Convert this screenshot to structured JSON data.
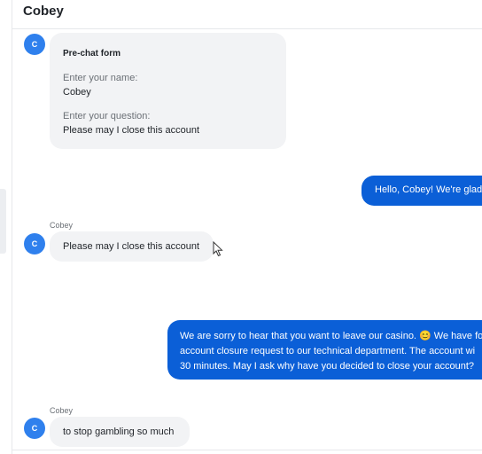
{
  "header": {
    "title": "Cobey"
  },
  "avatar_initial": "C",
  "prechat_form": {
    "title": "Pre-chat form",
    "name_label": "Enter your name:",
    "name_value": "Cobey",
    "question_label": "Enter your question:",
    "question_value": "Please may I close this account"
  },
  "messages": [
    {
      "direction": "outgoing",
      "text": "Hello, Cobey! We're glad"
    },
    {
      "direction": "incoming",
      "sender": "Cobey",
      "text": "Please may I close this account"
    },
    {
      "direction": "outgoing",
      "lines": [
        "We are sorry to hear that you want to leave our casino. 😊 We have fo",
        "account closure request to our technical department. The account wi",
        "30 minutes. May I ask why have you decided to close your account?"
      ]
    },
    {
      "direction": "incoming",
      "sender": "Cobey",
      "text": "to stop gambling so much"
    }
  ],
  "colors": {
    "accent": "#0b5fd7",
    "avatar": "#2f80ed",
    "incoming_bubble": "#f2f3f5"
  }
}
